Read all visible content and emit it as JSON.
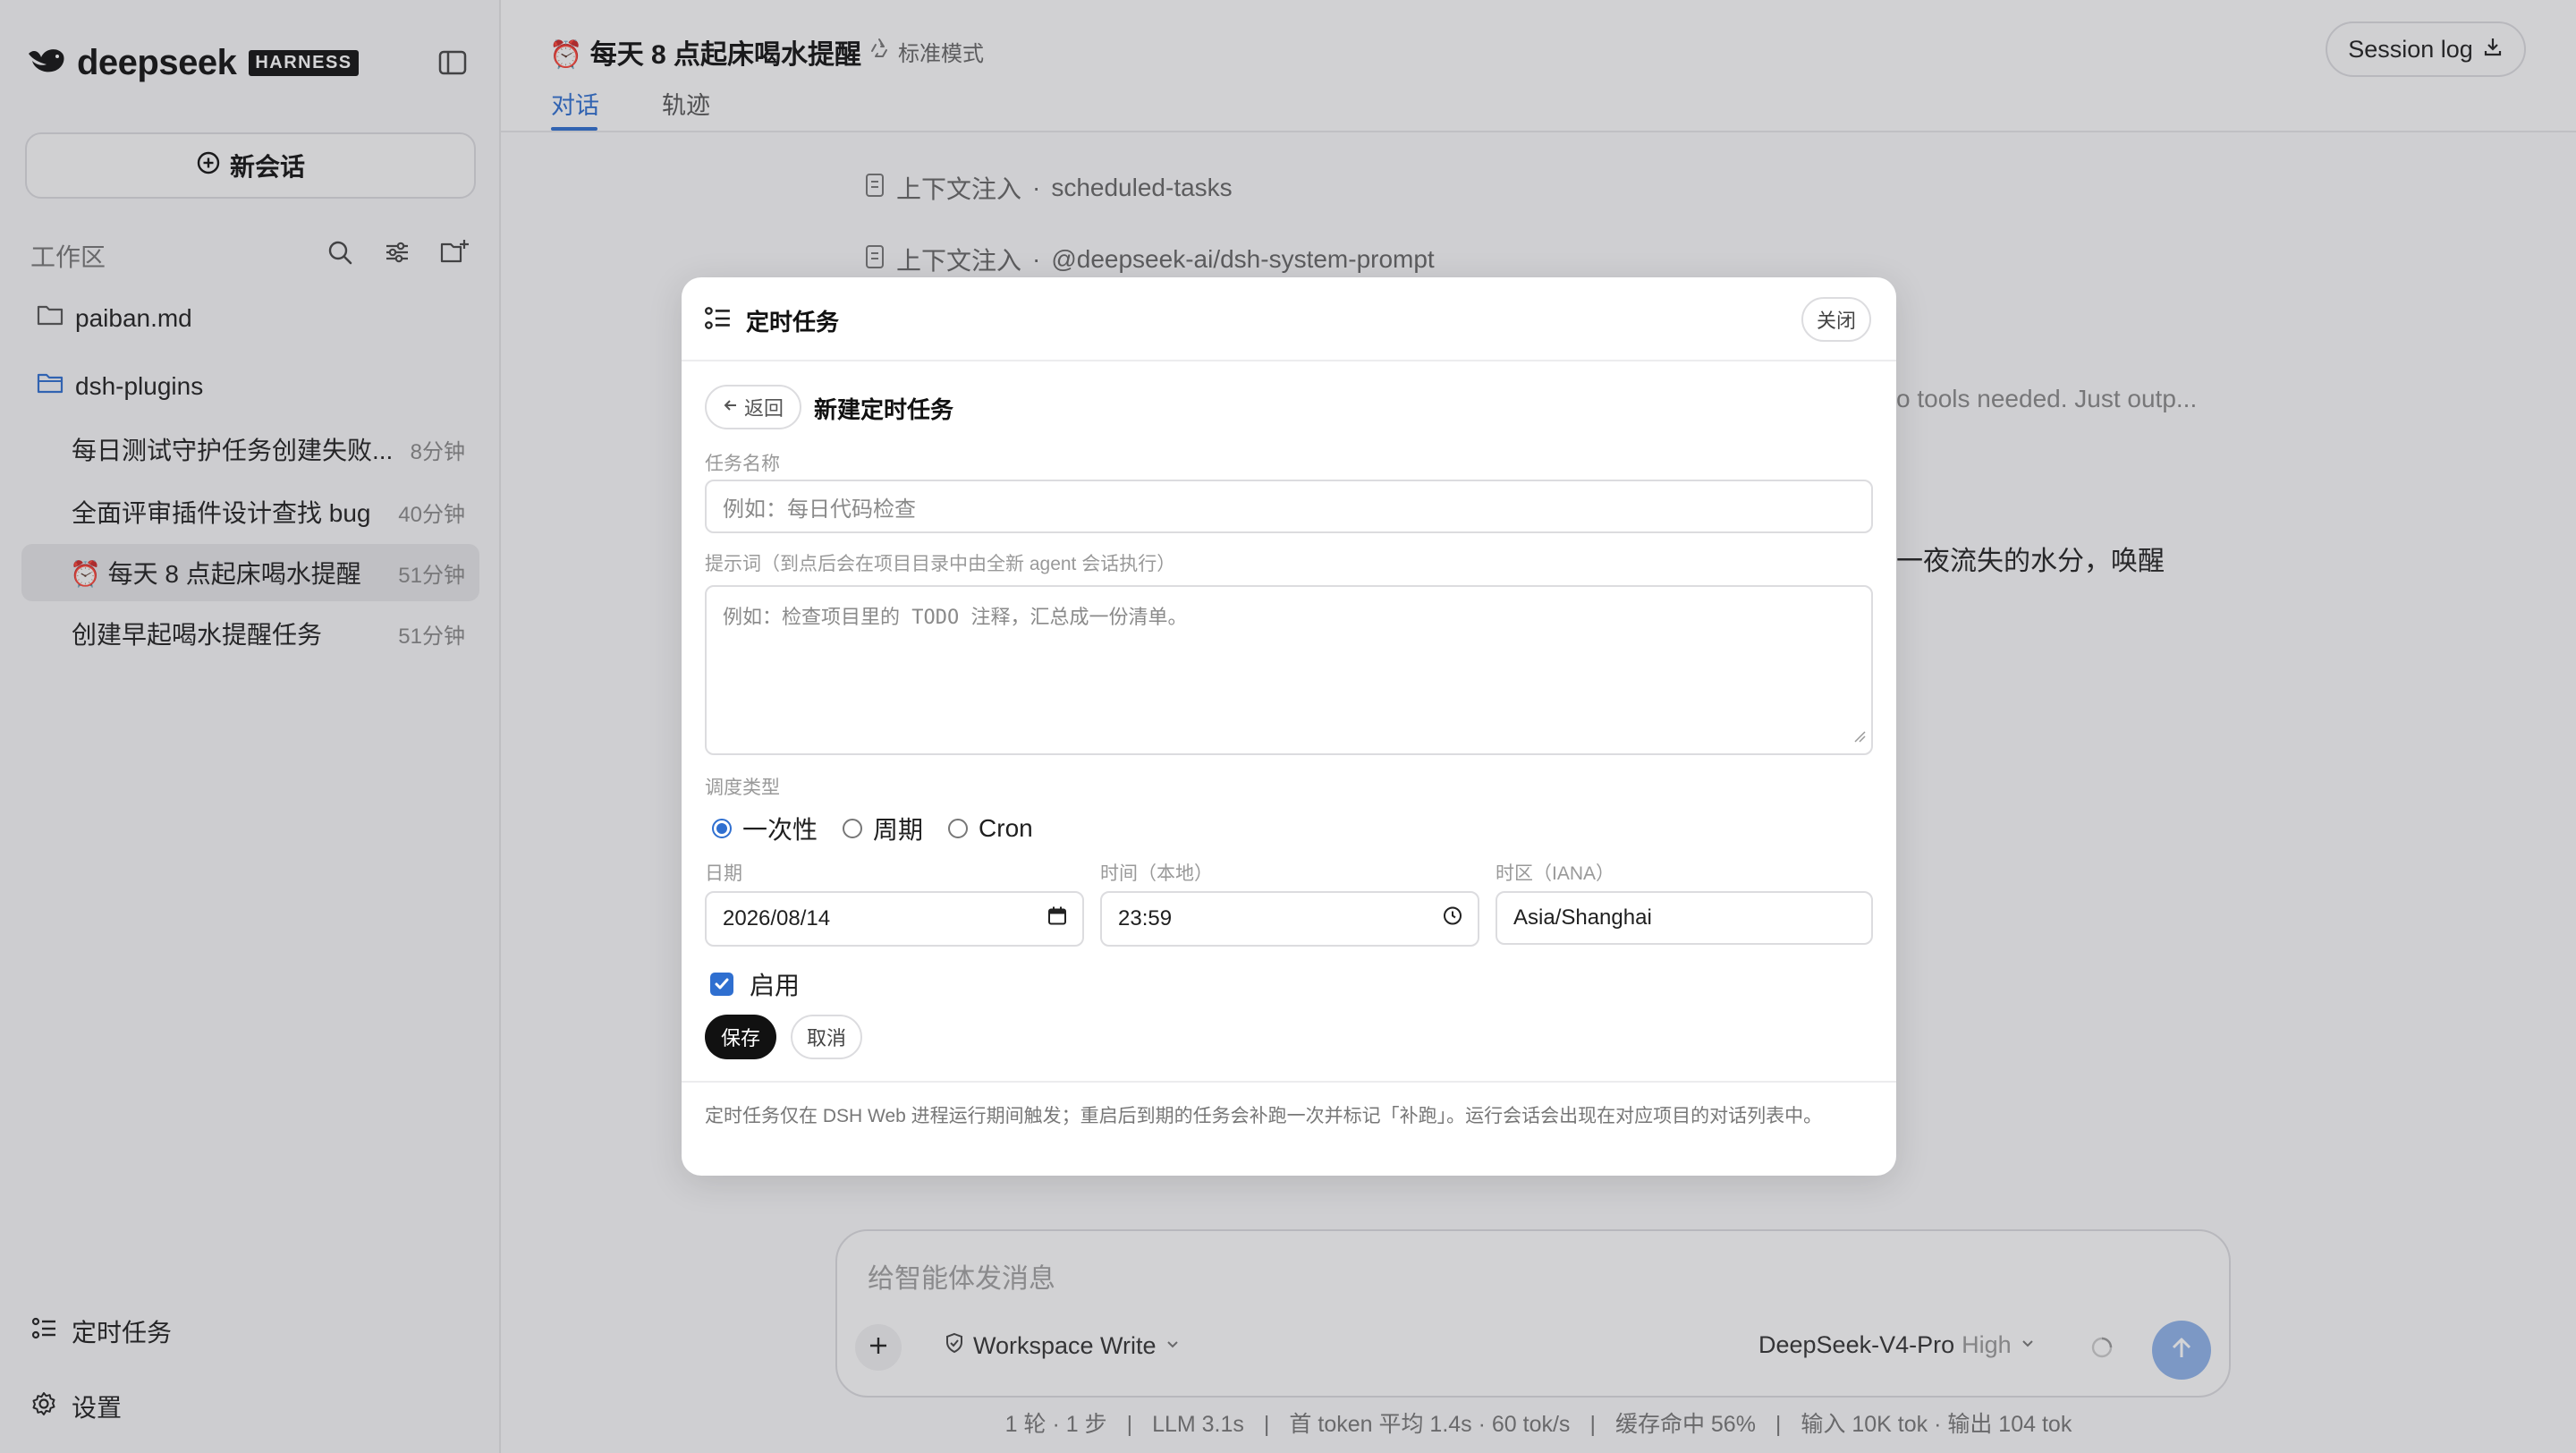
{
  "brand": {
    "name": "deepseek",
    "tag": "HARNESS"
  },
  "sidebar": {
    "new_chat_label": "新会话",
    "workspace_label": "工作区",
    "folders": [
      "paiban.md",
      "dsh-plugins"
    ],
    "sessions": [
      {
        "title": "每日测试守护任务创建失败...",
        "time": "8分钟"
      },
      {
        "title": "全面评审插件设计查找 bug",
        "time": "40分钟"
      },
      {
        "title": "⏰ 每天 8 点起床喝水提醒",
        "time": "51分钟",
        "active": true
      },
      {
        "title": "创建早起喝水提醒任务",
        "time": "51分钟"
      }
    ],
    "scheduled_label": "定时任务",
    "settings_label": "设置"
  },
  "header": {
    "title": "⏰ 每天 8 点起床喝水提醒",
    "mode": "标准模式",
    "session_log": "Session log",
    "tabs": [
      "对话",
      "轨迹"
    ],
    "active_tab": "对话"
  },
  "conversation": {
    "context_rows": [
      {
        "label": "上下文注入",
        "sep": "·",
        "value": "scheduled-tasks"
      },
      {
        "label": "上下文注入",
        "sep": "·",
        "value": "@deepseek-ai/dsh-system-prompt"
      }
    ],
    "partial_line_1": "o tools needed. Just outp...",
    "partial_line_2": "一夜流失的水分，唤醒"
  },
  "composer": {
    "placeholder": "给智能体发消息",
    "workspace_mode": "Workspace Write",
    "model": "DeepSeek-V4-Pro",
    "level": "High"
  },
  "stats": [
    "1 轮 · 1 步",
    "LLM 3.1s",
    "首 token 平均 1.4s · 60 tok/s",
    "缓存命中 56%",
    "输入 10K tok · 输出 104 tok"
  ],
  "modal": {
    "title": "定时任务",
    "close_label": "关闭",
    "back_label": "返回",
    "form_title": "新建定时任务",
    "name_label": "任务名称",
    "name_placeholder": "例如：每日代码检查",
    "prompt_label": "提示词（到点后会在项目目录中由全新 agent 会话执行）",
    "prompt_placeholder": "例如：检查项目里的 TODO 注释，汇总成一份清单。",
    "schedule_label": "调度类型",
    "schedule_options": [
      "一次性",
      "周期",
      "Cron"
    ],
    "schedule_selected": "一次性",
    "date_label": "日期",
    "date_value": "2026/08/14",
    "time_label": "时间（本地）",
    "time_value": "23:59",
    "tz_label": "时区（IANA）",
    "tz_value": "Asia/Shanghai",
    "enabled_label": "启用",
    "enabled": true,
    "save_label": "保存",
    "cancel_label": "取消",
    "footnote": "定时任务仅在 DSH Web 进程运行期间触发；重启后到期的任务会补跑一次并标记「补跑」。运行会话会出现在对应项目的对话列表中。"
  }
}
